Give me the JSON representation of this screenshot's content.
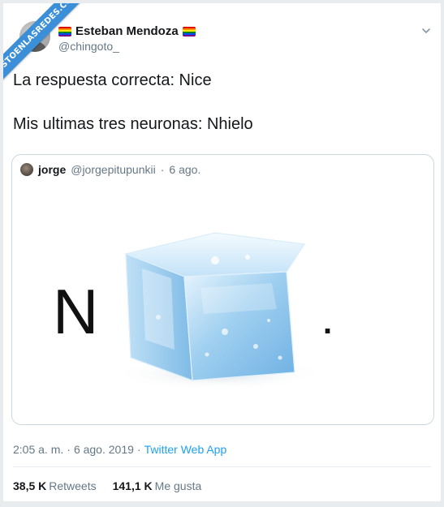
{
  "watermark": {
    "text": "VISTOENLASREDES.COM"
  },
  "tweet": {
    "author": {
      "display_name": "Esteban Mendoza",
      "handle": "@chingoto_"
    },
    "text_lines": [
      "La respuesta correcta: Nice",
      "Mis ultimas tres neuronas: Nhielo"
    ],
    "quoted": {
      "author_name": "jorge",
      "author_handle": "@jorgepitupunkii",
      "separator": "·",
      "date": "6 ago.",
      "media": {
        "letter": "N",
        "trailing": "."
      }
    },
    "meta": {
      "time": "2:05 a. m.",
      "separator": "·",
      "date": "6 ago. 2019",
      "separator2": "·",
      "app": "Twitter Web App"
    },
    "stats": {
      "retweets_value": "38,5 K",
      "retweets_label": "Retweets",
      "likes_value": "141,1 K",
      "likes_label": "Me gusta"
    }
  },
  "colors": {
    "accent_link": "#1da1f2",
    "ribbon": "#3a8fd8",
    "secondary_text": "#657786",
    "rainbow": [
      "#e40303",
      "#ff8c00",
      "#ffed00",
      "#008026",
      "#004dff",
      "#750787"
    ]
  },
  "icons": {
    "menu": "chevron-down-icon",
    "flag": "rainbow-flag-icon"
  }
}
